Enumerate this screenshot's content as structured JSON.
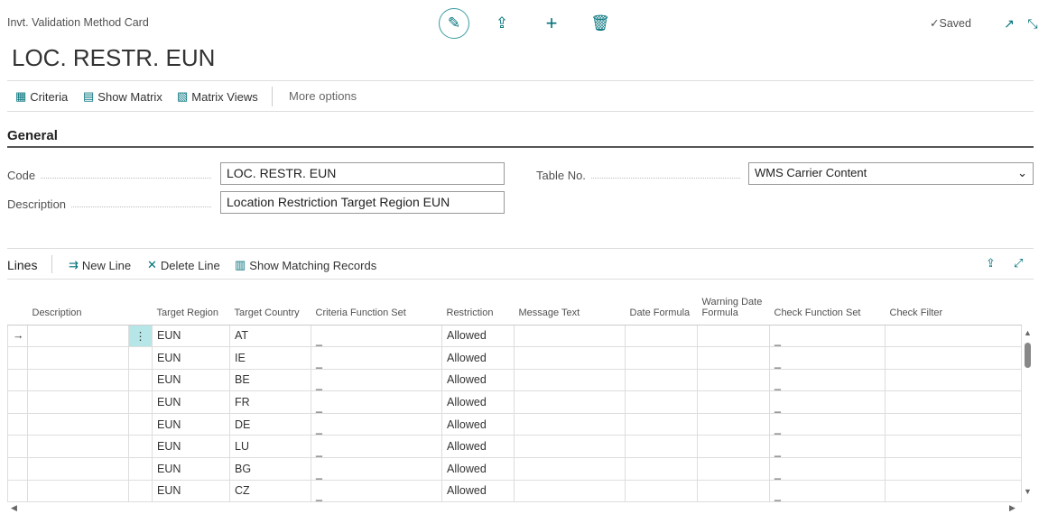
{
  "header": {
    "breadcrumb": "Invt. Validation Method Card",
    "saved": "Saved",
    "title": "LOC. RESTR. EUN"
  },
  "actions": {
    "criteria": "Criteria",
    "show_matrix": "Show Matrix",
    "matrix_views": "Matrix Views",
    "more": "More options"
  },
  "general": {
    "heading": "General",
    "code_label": "Code",
    "code_value": "LOC. RESTR. EUN",
    "desc_label": "Description",
    "desc_value": "Location Restriction Target Region EUN",
    "table_label": "Table No.",
    "table_value": "WMS Carrier Content"
  },
  "lines": {
    "heading": "Lines",
    "new_line": "New Line",
    "delete_line": "Delete Line",
    "show_matching": "Show Matching Records",
    "columns": [
      "Description",
      "Target Region",
      "Target Country",
      "Criteria Function Set",
      "Restriction",
      "Message Text",
      "Date Formula",
      "Warning Date Formula",
      "Check Function Set",
      "Check Filter"
    ],
    "rows": [
      {
        "region": "EUN",
        "country": "AT",
        "criteria": "_",
        "restriction": "Allowed",
        "check": "_"
      },
      {
        "region": "EUN",
        "country": "IE",
        "criteria": "_",
        "restriction": "Allowed",
        "check": "_"
      },
      {
        "region": "EUN",
        "country": "BE",
        "criteria": "_",
        "restriction": "Allowed",
        "check": "_"
      },
      {
        "region": "EUN",
        "country": "FR",
        "criteria": "_",
        "restriction": "Allowed",
        "check": "_"
      },
      {
        "region": "EUN",
        "country": "DE",
        "criteria": "_",
        "restriction": "Allowed",
        "check": "_"
      },
      {
        "region": "EUN",
        "country": "LU",
        "criteria": "_",
        "restriction": "Allowed",
        "check": "_"
      },
      {
        "region": "EUN",
        "country": "BG",
        "criteria": "_",
        "restriction": "Allowed",
        "check": "_"
      },
      {
        "region": "EUN",
        "country": "CZ",
        "criteria": "_",
        "restriction": "Allowed",
        "check": "_"
      }
    ]
  },
  "colors": {
    "accent": "#00707a",
    "selected_cell": "#b7e6e8"
  }
}
